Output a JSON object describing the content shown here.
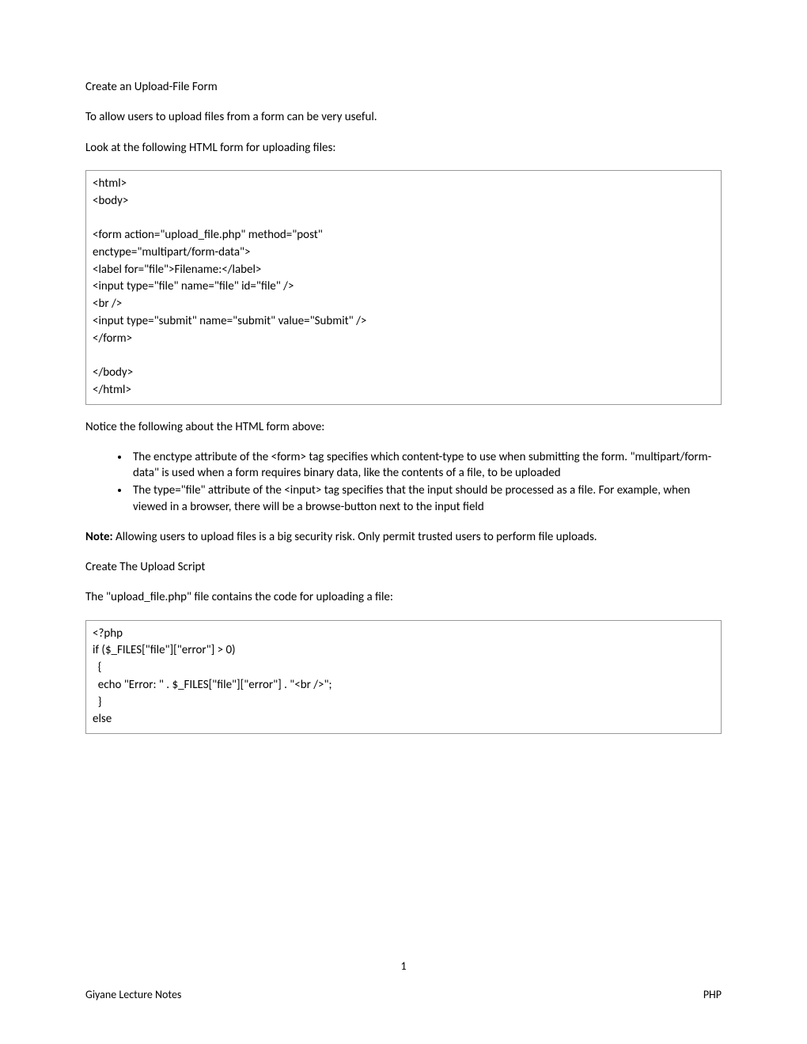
{
  "heading1": "Create an Upload-File Form",
  "p1": "To allow users to upload files from a form can be very useful.",
  "p2": "Look at the following HTML form for uploading files:",
  "code1": "<html>\n<body>\n\n<form action=\"upload_file.php\" method=\"post\"\nenctype=\"multipart/form-data\">\n<label for=\"file\">Filename:</label>\n<input type=\"file\" name=\"file\" id=\"file\" />\n<br />\n<input type=\"submit\" name=\"submit\" value=\"Submit\" />\n</form>\n\n</body>\n</html>",
  "p3": "Notice the following about the HTML form above:",
  "bullets": [
    "The enctype attribute of the <form> tag specifies which content-type to use when submitting the form. \"multipart/form-data\" is used when a form requires binary data, like the contents of a file, to be uploaded",
    "The type=\"file\" attribute of the <input> tag specifies that the input should be processed as a file. For example, when viewed in a browser, there will be a browse-button next to the input field"
  ],
  "note_label": "Note:",
  "note_text": " Allowing users to upload files is a big security risk. Only permit trusted users to perform file uploads.",
  "heading2": "Create The Upload Script",
  "p4": "The \"upload_file.php\" file contains the code for uploading a file:",
  "code2": "<?php\nif ($_FILES[\"file\"][\"error\"] > 0)\n  {\n  echo \"Error: \" . $_FILES[\"file\"][\"error\"] . \"<br />\";\n  }\nelse",
  "page_number": "1",
  "footer_left": "Giyane Lecture Notes",
  "footer_right": "PHP"
}
